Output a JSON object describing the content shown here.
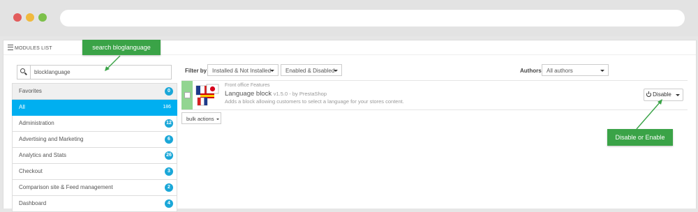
{
  "window": {
    "title": ""
  },
  "panel": {
    "title": "MODULES LIST"
  },
  "callouts": {
    "search": "search bloglanguage",
    "toggle": "Disable or Enable"
  },
  "search": {
    "value": "blocklanguage",
    "placeholder": ""
  },
  "categories": [
    {
      "label": "Favorites",
      "count": "0"
    },
    {
      "label": "All",
      "count": "186"
    },
    {
      "label": "Administration",
      "count": "12"
    },
    {
      "label": "Advertising and Marketing",
      "count": "6"
    },
    {
      "label": "Analytics and Stats",
      "count": "26"
    },
    {
      "label": "Checkout",
      "count": "3"
    },
    {
      "label": "Comparison site & Feed management",
      "count": "2"
    },
    {
      "label": "Dashboard",
      "count": "4"
    }
  ],
  "filters": {
    "label": "Filter by",
    "install_status": "Installed & Not Installed",
    "enable_status": "Enabled & Disabled",
    "authors_label": "Authors",
    "authors_value": "All authors"
  },
  "module": {
    "category": "Front office Features",
    "name": "Language block",
    "version": "v1.5.0 - by PrestaShop",
    "description": "Adds a block allowing customers to select a language for your stores content.",
    "action_label": "Disable"
  },
  "bulk": {
    "label": "bulk actions"
  },
  "colors": {
    "accent": "#00aff0",
    "callout": "#3aa347",
    "badge": "#1aa7d8",
    "installed_bar": "#92d591"
  }
}
